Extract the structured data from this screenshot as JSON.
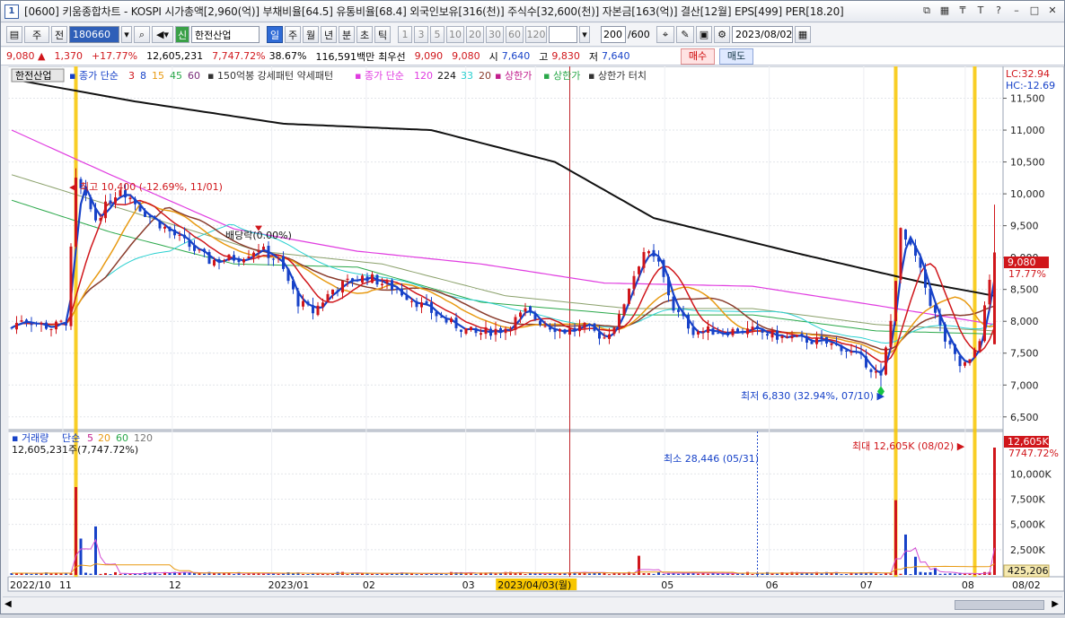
{
  "title": {
    "window_num": "1",
    "text": "[0600] 키움종합차트 - KOSPI 시가총액[2,960(억)] 부채비율[64.5] 유통비율[68.4] 외국인보유[316(천)] 주식수[32,600(천)] 자본금[163(억)] 결산[12월] EPS[499] PER[18.20]"
  },
  "toolbar": {
    "market": "주",
    "all_label": "전",
    "code": "180660",
    "sin_label": "신",
    "name": "한전산업",
    "periods": [
      "일",
      "주",
      "월",
      "년",
      "분",
      "초",
      "틱"
    ],
    "selected_period": "일",
    "numbers": [
      "1",
      "3",
      "5",
      "10",
      "20",
      "30",
      "60",
      "120"
    ],
    "count": "200",
    "count_max": "/600",
    "date": "2023/08/02"
  },
  "price": {
    "last": "9,080",
    "change": "1,370",
    "change_pct": "+17.77%",
    "volume": "12,605,231",
    "vol_ratio": "7,747.72%",
    "turnover": "38.67%",
    "amount": "116,591백만",
    "best_label": "최우선",
    "ask": "9,090",
    "bid": "9,080",
    "open_label": "시",
    "open": "7,640",
    "high_label": "고",
    "high": "9,830",
    "low_label": "저",
    "low": "7,640",
    "buy": "매수",
    "sell": "매도"
  },
  "legend": {
    "stock": "한전산업",
    "ma_label": "종가 단순",
    "ma_periods": [
      "3",
      "8",
      "15",
      "45",
      "60"
    ],
    "pattern": "150억봉 강세패턴  약세패턴",
    "ma2_label": "종가 단순",
    "ma2_periods": [
      "120",
      "224",
      "33",
      "20"
    ],
    "limit_up": "상한가",
    "limit_up2": "상한가",
    "limit_touch": "상한가 터치"
  },
  "axis": {
    "lc": "LC:32.94",
    "hc": "HC:-12.69",
    "price_ticks": [
      "11,500",
      "11,000",
      "10,500",
      "10,000",
      "9,500",
      "9,000",
      "8,500",
      "8,000",
      "7,500",
      "7,000",
      "6,500"
    ],
    "last_tag": "9,080",
    "last_pct": "17.77%",
    "vol_ticks": [
      "10,000K",
      "7,500K",
      "5,000K",
      "2,500K"
    ],
    "vol_top": "12,605K",
    "vol_top_pct": "7747.72%",
    "vol_last": "425,206",
    "x_ticks": [
      "2022/10",
      "11",
      "12",
      "2023/01",
      "02",
      "03",
      "2023/04/03(월)",
      "05",
      "06",
      "07",
      "08"
    ],
    "x_right": "08/02"
  },
  "annotations": {
    "high": "최고 10,400 (-12.69%, 11/01)",
    "dividend": "배당락(0.00%)",
    "low": "최저 6,830 (32.94%, 07/10)",
    "vol_min": "최소 28,446 (05/31)",
    "vol_max": "최대 12,605K (08/02)"
  },
  "volume_legend": {
    "label": "거래량",
    "ma_label": "단순",
    "periods": [
      "5",
      "20",
      "60",
      "120"
    ],
    "value": "12,605,231주(7,747.72%)"
  },
  "colors": {
    "up": "#d0161b",
    "down": "#1742c8",
    "ma3": "#d0161b",
    "ma8": "#1742c8",
    "ma15": "#e89a12",
    "ma45": "#2aa84a",
    "ma60": "#7a2c7a",
    "ma120": "#e03ce0",
    "ma224": "#111111",
    "ma33": "#2ad0d0",
    "ma20": "#8a3c2c",
    "highlight": "#f7c600"
  },
  "chart_data": {
    "type": "candlestick",
    "x_range": [
      "2022/10",
      "2023/08/02"
    ],
    "ylim": [
      6300,
      12000
    ],
    "close_trend": [
      {
        "x": "2022/10",
        "y": 7900
      },
      {
        "x": "11/01",
        "y": 10400
      },
      {
        "x": "11",
        "y": 9900
      },
      {
        "x": "12",
        "y": 8900
      },
      {
        "x": "2023/01",
        "y": 8300
      },
      {
        "x": "02",
        "y": 8700
      },
      {
        "x": "03",
        "y": 7900
      },
      {
        "x": "04",
        "y": 7800
      },
      {
        "x": "04/20",
        "y": 9300
      },
      {
        "x": "05",
        "y": 7800
      },
      {
        "x": "06",
        "y": 7800
      },
      {
        "x": "07/10",
        "y": 6830
      },
      {
        "x": "07/12",
        "y": 9400
      },
      {
        "x": "07",
        "y": 7700
      },
      {
        "x": "08/01",
        "y": 7710
      },
      {
        "x": "08/02",
        "y": 9080
      }
    ],
    "ma224": [
      {
        "x": "2022/10",
        "y": 11800
      },
      {
        "x": "12",
        "y": 11050
      },
      {
        "x": "2023/01",
        "y": 10900
      },
      {
        "x": "04",
        "y": 9550
      },
      {
        "x": "06",
        "y": 8950
      },
      {
        "x": "07",
        "y": 8700
      },
      {
        "x": "08/02",
        "y": 8400
      }
    ],
    "ma120": [
      {
        "x": "2022/10",
        "y": 11000
      },
      {
        "x": "12",
        "y": 9500
      },
      {
        "x": "2023/01",
        "y": 9200
      },
      {
        "x": "04",
        "y": 8600
      },
      {
        "x": "06",
        "y": 8500
      },
      {
        "x": "08/02",
        "y": 8000
      }
    ],
    "volume_max_k": 12605
  }
}
